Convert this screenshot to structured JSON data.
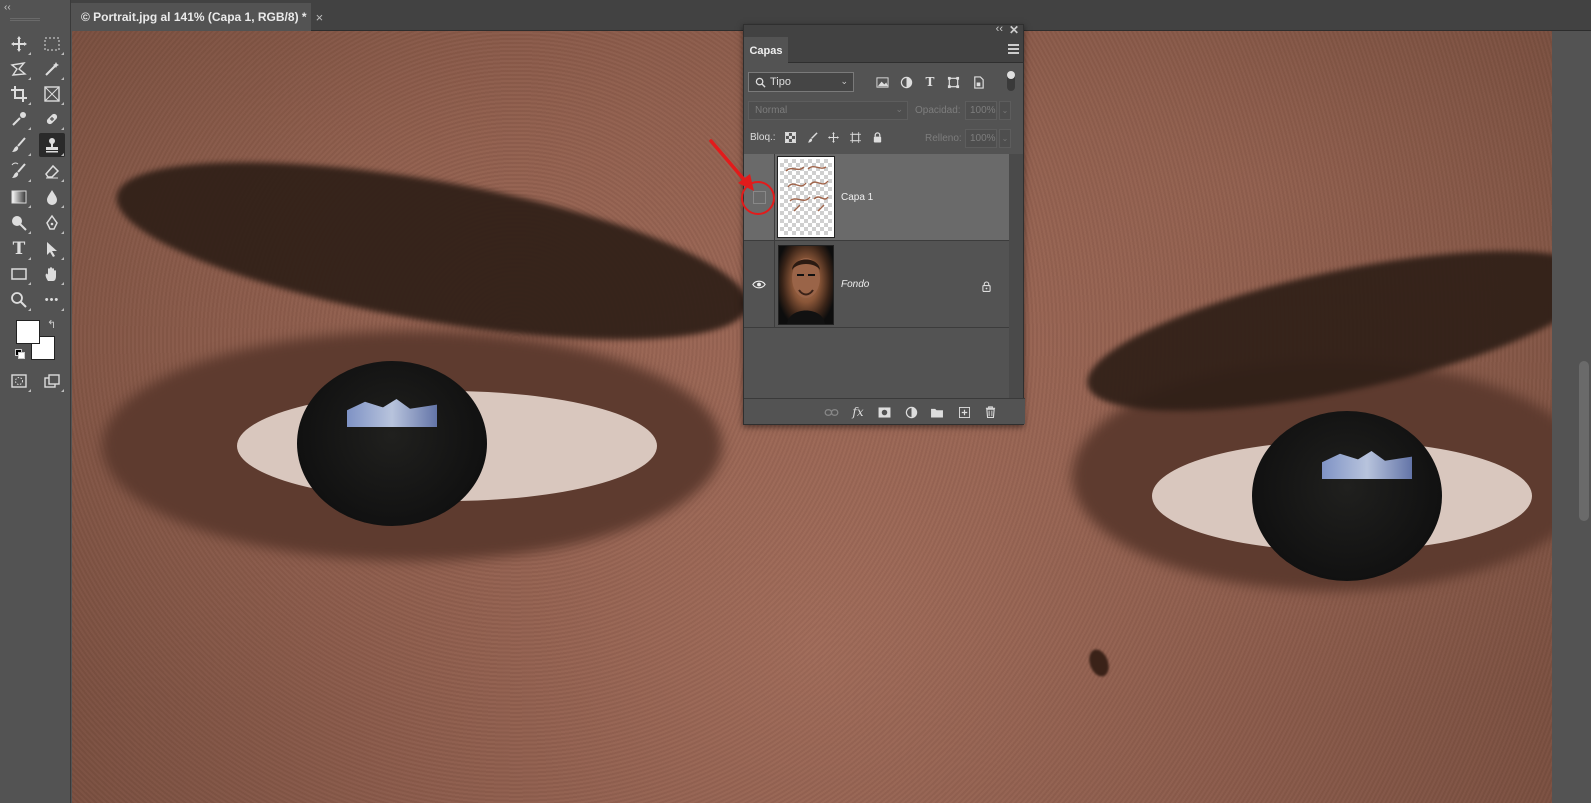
{
  "document_tab": {
    "title": "© Portrait.jpg al 141% (Capa 1, RGB/8) *",
    "close": "×"
  },
  "toolbar": {
    "collapse": "‹‹",
    "tools": [
      "move-tool",
      "marquee-tool",
      "lasso-tool",
      "magic-wand-tool",
      "crop-tool",
      "frame-tool",
      "eyedropper-tool",
      "healing-brush-tool",
      "brush-tool",
      "clone-stamp-tool",
      "history-brush-tool",
      "eraser-tool",
      "gradient-tool",
      "blur-tool",
      "dodge-tool",
      "pen-tool",
      "type-tool",
      "path-selection-tool",
      "rectangle-tool",
      "hand-tool",
      "zoom-tool",
      "more-tools"
    ],
    "active_tool": "clone-stamp-tool",
    "type_glyph": "T",
    "more_glyph": "•••",
    "swap_glyph": "↰",
    "foreground_color": "#ffffff",
    "background_color": "#ffffff"
  },
  "layers_panel": {
    "collapse": "‹‹",
    "close": "✕",
    "tab_label": "Capas",
    "filter": {
      "value": "Tipo",
      "chevron": "⌄"
    },
    "blend_mode": "Normal",
    "opacity_label": "Opacidad:",
    "opacity_value": "100%",
    "lock_label": "Bloq.:",
    "fill_label": "Relleno:",
    "fill_value": "100%",
    "layers": [
      {
        "name": "Capa 1",
        "visible": false,
        "selected": true,
        "locked": false
      },
      {
        "name": "Fondo",
        "visible": true,
        "selected": false,
        "locked": true
      }
    ],
    "footer_fx": "fx"
  },
  "colors": {
    "ui_bg": "#535353",
    "panel_dark": "#424242",
    "selected_layer": "#6a6a6a",
    "annotation_red": "#e21b1b"
  }
}
